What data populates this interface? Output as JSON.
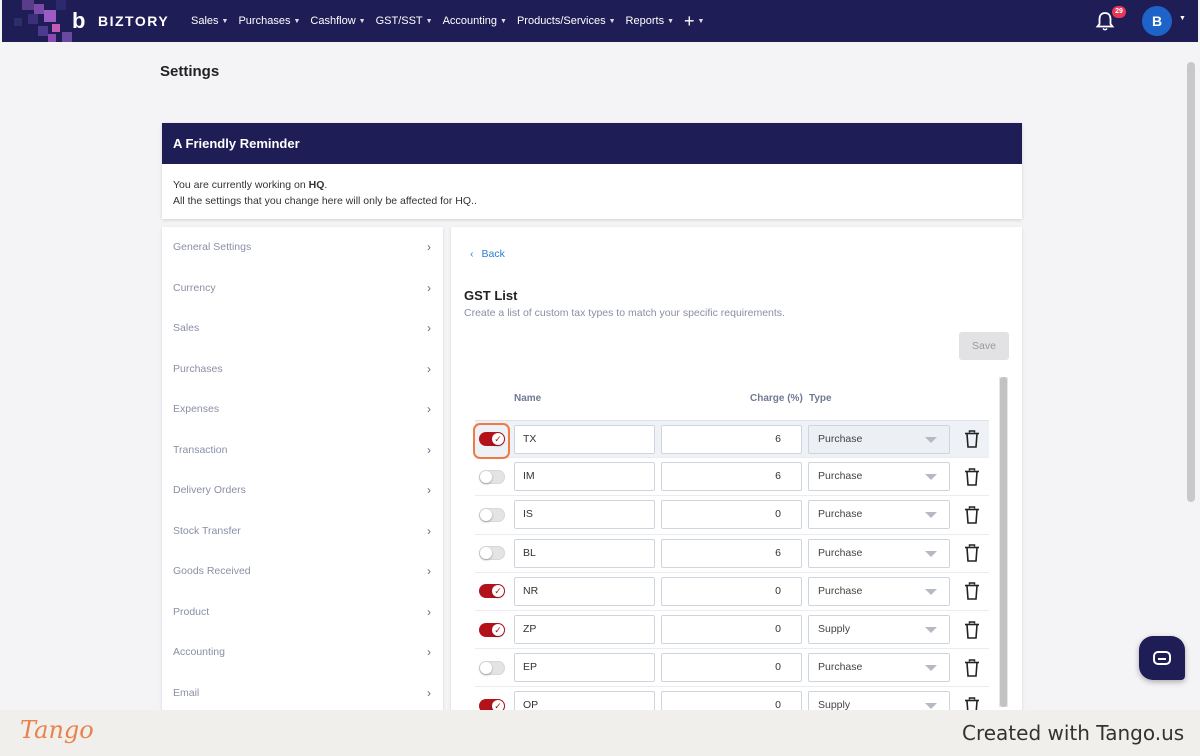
{
  "brand": {
    "name": "BIZTORY"
  },
  "nav": {
    "items": [
      {
        "label": "Sales"
      },
      {
        "label": "Purchases"
      },
      {
        "label": "Cashflow"
      },
      {
        "label": "GST/SST"
      },
      {
        "label": "Accounting"
      },
      {
        "label": "Products/Services"
      },
      {
        "label": "Reports"
      }
    ],
    "notification_count": "29",
    "avatar_initial": "B"
  },
  "page": {
    "title": "Settings"
  },
  "reminder": {
    "title": "A Friendly Reminder",
    "line1_prefix": "You are currently working on ",
    "line1_bold": "HQ",
    "line1_suffix": ".",
    "line2": "All the settings that you change here will only be affected for HQ.."
  },
  "sidebar": {
    "items": [
      {
        "label": "General Settings"
      },
      {
        "label": "Currency"
      },
      {
        "label": "Sales"
      },
      {
        "label": "Purchases"
      },
      {
        "label": "Expenses"
      },
      {
        "label": "Transaction"
      },
      {
        "label": "Delivery Orders"
      },
      {
        "label": "Stock Transfer"
      },
      {
        "label": "Goods Received"
      },
      {
        "label": "Product"
      },
      {
        "label": "Accounting"
      },
      {
        "label": "Email"
      }
    ]
  },
  "gst": {
    "back_label": "Back",
    "title": "GST List",
    "subtitle": "Create a list of custom tax types to match your specific requirements.",
    "save_label": "Save",
    "columns": {
      "name": "Name",
      "charge": "Charge (%)",
      "type": "Type"
    },
    "rows": [
      {
        "enabled": true,
        "name": "TX",
        "charge": "6",
        "type": "Purchase"
      },
      {
        "enabled": false,
        "name": "IM",
        "charge": "6",
        "type": "Purchase"
      },
      {
        "enabled": false,
        "name": "IS",
        "charge": "0",
        "type": "Purchase"
      },
      {
        "enabled": false,
        "name": "BL",
        "charge": "6",
        "type": "Purchase"
      },
      {
        "enabled": true,
        "name": "NR",
        "charge": "0",
        "type": "Purchase"
      },
      {
        "enabled": true,
        "name": "ZP",
        "charge": "0",
        "type": "Supply"
      },
      {
        "enabled": false,
        "name": "EP",
        "charge": "0",
        "type": "Purchase"
      },
      {
        "enabled": true,
        "name": "OP",
        "charge": "0",
        "type": "Supply"
      }
    ]
  },
  "colors": {
    "nav_bg": "#1f1d55",
    "toggle_on": "#b3121a",
    "accent_link": "#2a7ed0",
    "highlight": "#ef7a45"
  },
  "footer": {
    "logo": "Tango",
    "created": "Created with Tango.us"
  }
}
